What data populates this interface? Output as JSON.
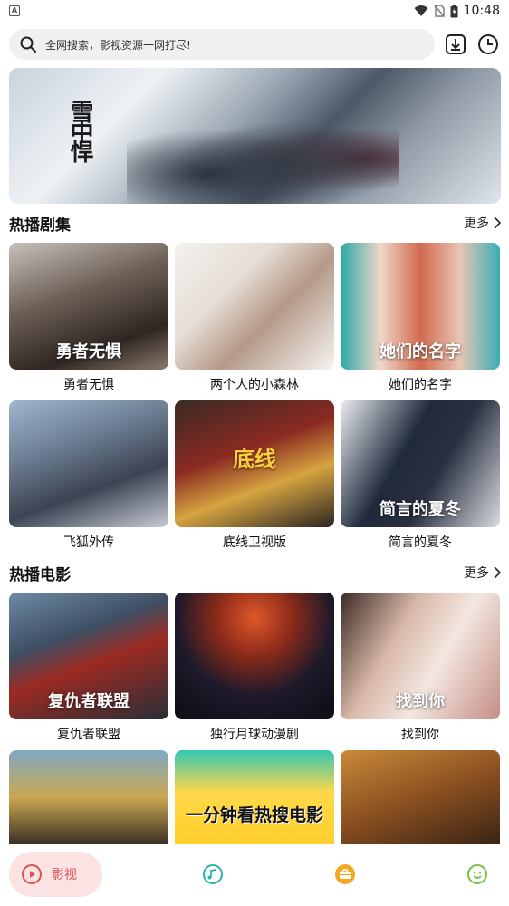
{
  "status_bar": {
    "notification_glyph": "A",
    "time": "10:48"
  },
  "search": {
    "placeholder": "全网搜索，影视资源一网打尽!"
  },
  "banner": {
    "title_calligraphy": "雪中悍"
  },
  "sections": {
    "hot_series": {
      "title": "热播剧集",
      "more": "更多",
      "items": [
        {
          "title": "勇者无惧",
          "poster_text": "勇者无惧"
        },
        {
          "title": "两个人的小森林",
          "poster_text": ""
        },
        {
          "title": "她们的名字",
          "poster_text": "她们的名字"
        },
        {
          "title": "飞狐外传",
          "poster_text": ""
        },
        {
          "title": "底线卫视版",
          "poster_text": "底线"
        },
        {
          "title": "简言的夏冬",
          "poster_text": "简言的夏冬"
        }
      ]
    },
    "hot_movies": {
      "title": "热播电影",
      "more": "更多",
      "items": [
        {
          "title": "复仇者联盟",
          "poster_text": "复仇者联盟"
        },
        {
          "title": "独行月球动漫剧",
          "poster_text": ""
        },
        {
          "title": "找到你",
          "poster_text": "找到你"
        }
      ],
      "partial_items": [
        {
          "poster_text": ""
        },
        {
          "poster_text": "一分钟看热搜电影"
        },
        {
          "poster_text": ""
        }
      ]
    }
  },
  "bottom_nav": {
    "active_label": "影视",
    "active_color": "#e25050",
    "icons": [
      "play-circle-icon",
      "music-disc-icon",
      "briefcase-icon",
      "smiley-icon"
    ]
  },
  "colors": {
    "accent_red": "#e25050",
    "music_teal": "#2bb5a3",
    "case_orange": "#f5a623",
    "smile_green": "#7cc043"
  }
}
